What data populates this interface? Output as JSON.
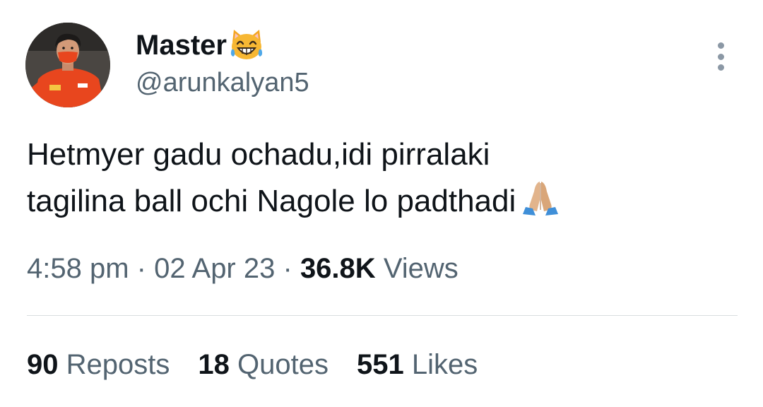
{
  "author": {
    "display_name": "Master",
    "name_emoji": "grinning-cat-with-smiling-eyes-icon",
    "handle": "@arunkalyan5"
  },
  "tweet": {
    "lines": [
      "Hetmyer gadu ochadu,idi pirralaki",
      "tagilina ball ochi Nagole lo padthadi"
    ],
    "trailing_emoji": "folded-hands-icon"
  },
  "meta": {
    "time": "4:58 pm",
    "separator": "·",
    "date": "02 Apr 23",
    "views_count": "36.8K",
    "views_label": "Views"
  },
  "stats": {
    "reposts_count": "90",
    "reposts_label": "Reposts",
    "quotes_count": "18",
    "quotes_label": "Quotes",
    "likes_count": "551",
    "likes_label": "Likes"
  },
  "colors": {
    "primary_text": "#0f1419",
    "secondary_text": "#536471",
    "divider": "#d9dde0"
  }
}
